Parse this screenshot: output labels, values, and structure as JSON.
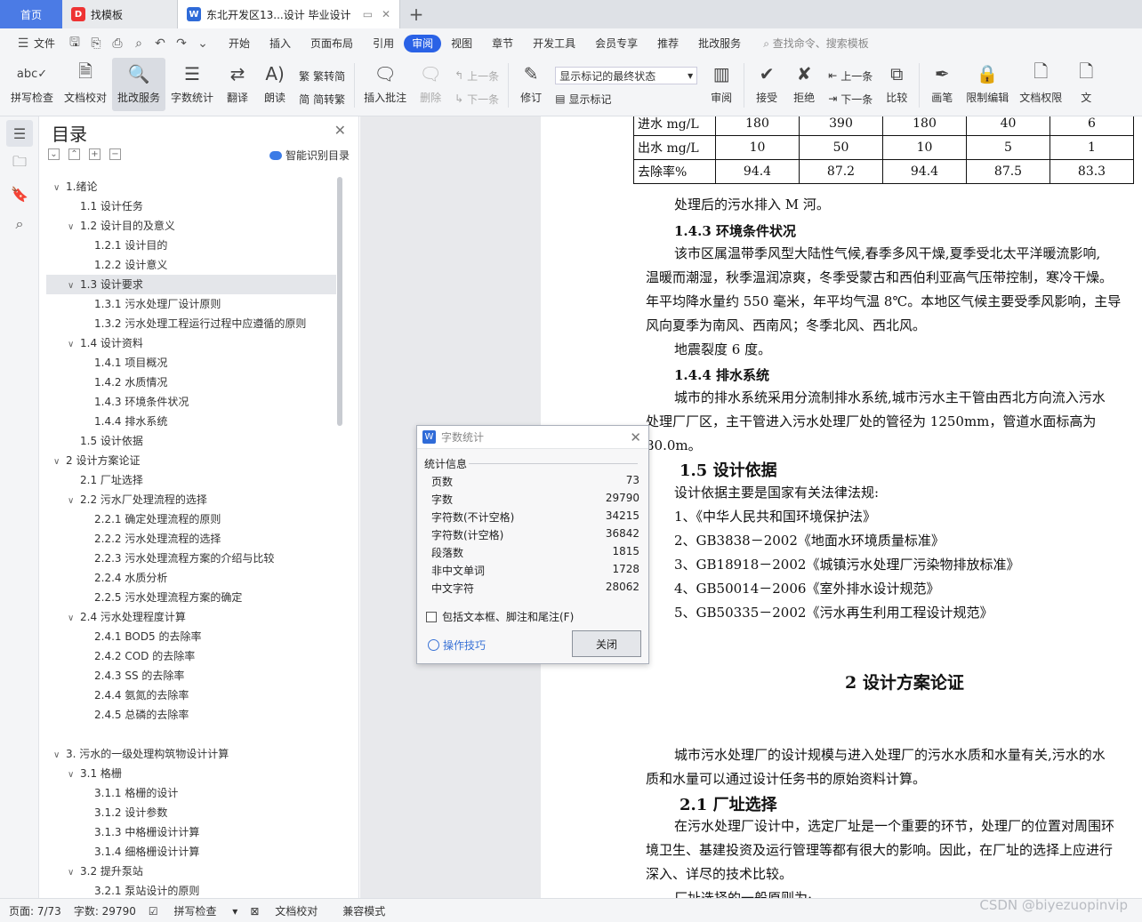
{
  "tabs": {
    "home": "首页",
    "tab1": "找模板",
    "tab2": "东北开发区13...设计 毕业设计"
  },
  "menu": {
    "file": "文件",
    "items": [
      "开始",
      "插入",
      "页面布局",
      "引用",
      "审阅",
      "视图",
      "章节",
      "开发工具",
      "会员专享",
      "推荐",
      "批改服务"
    ],
    "active": "审阅",
    "search": "查找命令、搜索模板"
  },
  "ribbon": {
    "spell": "拼写检查",
    "proof": "文档校对",
    "review_service": "批改服务",
    "word_count": "字数统计",
    "translate": "翻译",
    "read": "朗读",
    "trad": "繁转简",
    "simp": "简转繁",
    "insert_comment": "插入批注",
    "delete": "删除",
    "prev": "上一条",
    "next": "下一条",
    "revise": "修订",
    "markup_dropdown": "显示标记的最终状态",
    "show_markup": "显示标记",
    "review": "审阅",
    "accept": "接受",
    "reject": "拒绝",
    "prev2": "上一条",
    "next2": "下一条",
    "compare": "比较",
    "pen": "画笔",
    "restrict": "限制编辑",
    "permission": "文档权限",
    "more": "文"
  },
  "toc": {
    "title": "目录",
    "smart": "智能识别目录",
    "items": [
      {
        "text": "1.绪论",
        "level": "l1",
        "arrow": "v"
      },
      {
        "text": "1.1 设计任务",
        "level": "l2n"
      },
      {
        "text": "1.2 设计目的及意义",
        "level": "l2",
        "arrow": "v"
      },
      {
        "text": "1.2.1 设计目的",
        "level": "l3"
      },
      {
        "text": "1.2.2 设计意义",
        "level": "l3"
      },
      {
        "text": "1.3 设计要求",
        "level": "l2",
        "arrow": "v",
        "sel": true
      },
      {
        "text": "1.3.1 污水处理厂设计原则",
        "level": "l3"
      },
      {
        "text": "1.3.2 污水处理工程运行过程中应遵循的原则",
        "level": "l3"
      },
      {
        "text": "1.4 设计资料",
        "level": "l2",
        "arrow": "v"
      },
      {
        "text": "1.4.1 项目概况",
        "level": "l3"
      },
      {
        "text": "1.4.2 水质情况",
        "level": "l3"
      },
      {
        "text": "1.4.3 环境条件状况",
        "level": "l3"
      },
      {
        "text": "1.4.4 排水系统",
        "level": "l3"
      },
      {
        "text": "1.5 设计依据",
        "level": "l2n"
      },
      {
        "text": "2  设计方案论证",
        "level": "l1",
        "arrow": "v"
      },
      {
        "text": "2.1 厂址选择",
        "level": "l2n"
      },
      {
        "text": "2.2 污水厂处理流程的选择",
        "level": "l2",
        "arrow": "v"
      },
      {
        "text": "2.2.1 确定处理流程的原则",
        "level": "l3"
      },
      {
        "text": "2.2.2 污水处理流程的选择",
        "level": "l3"
      },
      {
        "text": "2.2.3 污水处理流程方案的介绍与比较",
        "level": "l3"
      },
      {
        "text": "2.2.4 水质分析",
        "level": "l3"
      },
      {
        "text": "2.2.5 污水处理流程方案的确定",
        "level": "l3"
      },
      {
        "text": "2.4 污水处理程度计算",
        "level": "l2",
        "arrow": "v"
      },
      {
        "text": "2.4.1    BOD5 的去除率",
        "level": "l3"
      },
      {
        "text": "2.4.2 COD 的去除率",
        "level": "l3"
      },
      {
        "text": "2.4.3 SS 的去除率",
        "level": "l3"
      },
      {
        "text": "2.4.4 氨氮的去除率",
        "level": "l3"
      },
      {
        "text": "2.4.5 总磷的去除率",
        "level": "l3"
      },
      {
        "text": "",
        "level": "gap"
      },
      {
        "text": "3. 污水的一级处理构筑物设计计算",
        "level": "l1",
        "arrow": "v"
      },
      {
        "text": "3.1 格栅",
        "level": "l2",
        "arrow": "v"
      },
      {
        "text": "3.1.1 格栅的设计",
        "level": "l3"
      },
      {
        "text": "3.1.2 设计参数",
        "level": "l3"
      },
      {
        "text": "3.1.3 中格栅设计计算",
        "level": "l3"
      },
      {
        "text": "3.1.4 细格栅设计计算",
        "level": "l3"
      },
      {
        "text": "3.2 提升泵站",
        "level": "l2",
        "arrow": "v"
      },
      {
        "text": "3.2.1 泵站设计的原则",
        "level": "l3"
      }
    ]
  },
  "doc": {
    "table": [
      [
        "进水 mg/L",
        "180",
        "390",
        "180",
        "40",
        "6"
      ],
      [
        "出水 mg/L",
        "10",
        "50",
        "10",
        "5",
        "1"
      ],
      [
        "去除率%",
        "94.4",
        "87.2",
        "94.4",
        "87.5",
        "83.3"
      ]
    ],
    "p_after_table": "处理后的污水排入 M 河。",
    "h143": "1.4.3 环境条件状况",
    "p143_1": "该市区属温带季风型大陆性气候,春季多风干燥,夏季受北太平洋暖流影响,",
    "p143_2": "温暖而潮湿，秋季温润凉爽，冬季受蒙古和西伯利亚高气压带控制，寒冷干燥。",
    "p143_3": "年平均降水量约 550 毫米，年平均气温 8℃。本地区气候主要受季风影响，主导",
    "p143_4": "风向夏季为南风、西南风；冬季北风、西北风。",
    "p143_5": "地震裂度 6 度。",
    "h144": "1.4.4 排水系统",
    "p144_1": "城市的排水系统采用分流制排水系统,城市污水主干管由西北方向流入污水",
    "p144_2": "处理厂厂区，主干管进入污水处理厂处的管径为 1250mm，管道水面标高为",
    "p144_3": "80.0m。",
    "h15": "1.5 设计依据",
    "p15_0": "设计依据主要是国家有关法律法规:",
    "p15_1": "1、《中华人民共和国环境保护法》",
    "p15_2": "2、GB3838－2002《地面水环境质量标准》",
    "p15_3": "3、GB18918－2002《城镇污水处理厂污染物排放标准》",
    "p15_4": "4、GB50014－2006《室外排水设计规范》",
    "p15_5": "5、GB50335－2002《污水再生利用工程设计规范》",
    "h2": "2  设计方案论证",
    "p2_1": "城市污水处理厂的设计规模与进入处理厂的污水水质和水量有关,污水的水",
    "p2_2": "质和水量可以通过设计任务书的原始资料计算。",
    "h21": "2.1 厂址选择",
    "p21_1": "在污水处理厂设计中，选定厂址是一个重要的环节，处理厂的位置对周围环",
    "p21_2": "境卫生、基建投资及运行管理等都有很大的影响。因此，在厂址的选择上应进行",
    "p21_3": "深入、详尽的技术比较。",
    "p21_4": "厂址选择的一般原则为:"
  },
  "dialog": {
    "title": "字数统计",
    "group": "统计信息",
    "rows": [
      {
        "label": "页数",
        "value": "73"
      },
      {
        "label": "字数",
        "value": "29790"
      },
      {
        "label": "字符数(不计空格)",
        "value": "34215"
      },
      {
        "label": "字符数(计空格)",
        "value": "36842"
      },
      {
        "label": "段落数",
        "value": "1815"
      },
      {
        "label": "非中文单词",
        "value": "1728"
      },
      {
        "label": "中文字符",
        "value": "28062"
      }
    ],
    "checkbox": "包括文本框、脚注和尾注(F)",
    "tips": "操作技巧",
    "close": "关闭"
  },
  "status": {
    "page": "页面: 7/73",
    "words": "字数: 29790",
    "spell": "拼写检查",
    "proof": "文档校对",
    "compat": "兼容模式"
  },
  "watermark": "CSDN @biyezuopinvip"
}
